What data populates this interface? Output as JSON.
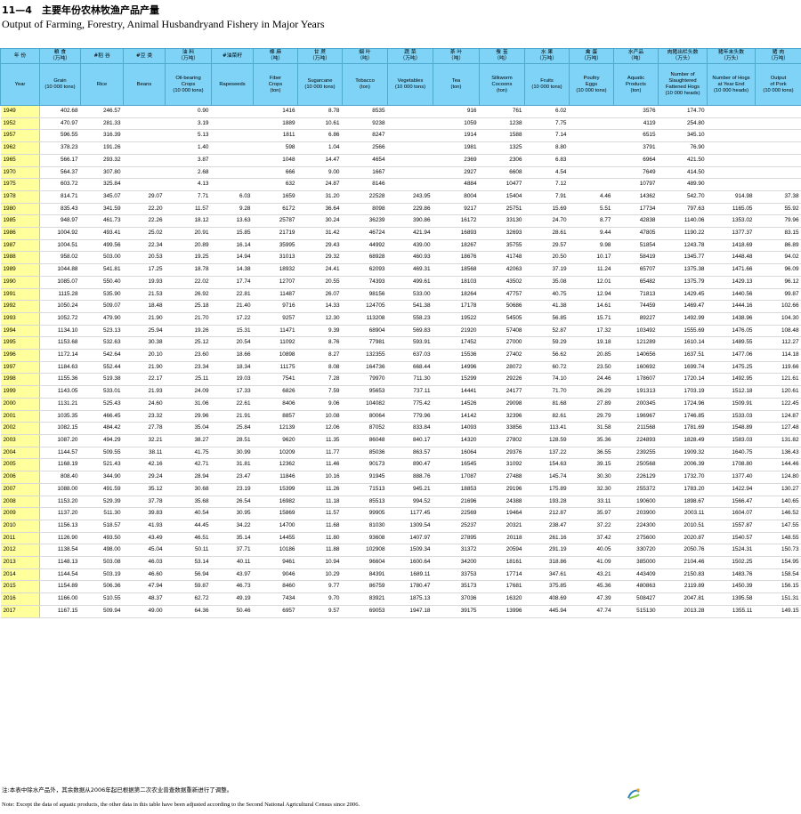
{
  "title": {
    "cn": "11—4　主要年份农林牧渔产品产量",
    "en": "Output of Farming, Forestry, Animal Husbandryand Fishery in Major Years"
  },
  "header_cn": [
    "年 份",
    "粮 食\n（万吨）",
    "#稻 谷",
    "#豆 类",
    "油 料\n（万吨）",
    "#油菜籽",
    "棉 麻\n（吨）",
    "甘 蔗\n（万吨）",
    "烟 叶\n（吨）",
    "蔬 菜\n（万吨）",
    "茶 叶\n（吨）",
    "蚕 茧\n（吨）",
    "水 果\n（万吨）",
    "禽 蛋\n（万吨）",
    "水产品\n（吨）",
    "肉猪出栏头数\n（万头）",
    "猪年末头数\n（万头）",
    "猪 肉\n（万吨）"
  ],
  "header_en": [
    "Year",
    "Grain\n(10 000 tons)",
    "Rice",
    "Beans",
    "Oil-bearing\nCrops\n(10 000 tons)",
    "Rapeseeds",
    "Fiber\nCrops\n(ton)",
    "Sugarcane\n(10 000 tons)",
    "Tobacco\n(ton)",
    "Vegetables\n(10 000 tons)",
    "Tea\n(ton)",
    "Silkworm\nCocoons\n(ton)",
    "Fruits\n(10 000 tons)",
    "Poultry\nEggs\n(10 000 tons)",
    "Aquatic\nProducts\n(ton)",
    "Number of\nSlaughtered\nFattened Hogs\n(10 000 heads)",
    "Number of Hogs\nat Year End\n(10 000 heads)",
    "Output\nof Pork\n(10 000 tons)"
  ],
  "rows": [
    [
      "1949",
      "402.68",
      "246.57",
      "",
      "0.90",
      "",
      "1416",
      "8.78",
      "8535",
      "",
      "916",
      "761",
      "6.02",
      "",
      "3576",
      "174.70",
      "",
      ""
    ],
    [
      "1952",
      "470.97",
      "281.33",
      "",
      "3.19",
      "",
      "1889",
      "10.61",
      "9238",
      "",
      "1059",
      "1238",
      "7.75",
      "",
      "4119",
      "254.80",
      "",
      ""
    ],
    [
      "1957",
      "596.55",
      "316.39",
      "",
      "5.13",
      "",
      "1811",
      "6.86",
      "8247",
      "",
      "1914",
      "1588",
      "7.14",
      "",
      "6515",
      "345.10",
      "",
      ""
    ],
    [
      "1962",
      "378.23",
      "191.26",
      "",
      "1.40",
      "",
      "598",
      "1.04",
      "2566",
      "",
      "1981",
      "1325",
      "8.80",
      "",
      "3791",
      "76.90",
      "",
      ""
    ],
    [
      "1965",
      "566.17",
      "293.32",
      "",
      "3.87",
      "",
      "1048",
      "14.47",
      "4654",
      "",
      "2369",
      "2306",
      "6.83",
      "",
      "6964",
      "421.50",
      "",
      ""
    ],
    [
      "1970",
      "564.37",
      "307.80",
      "",
      "2.68",
      "",
      "666",
      "9.00",
      "1667",
      "",
      "2927",
      "6608",
      "4.54",
      "",
      "7649",
      "414.50",
      "",
      ""
    ],
    [
      "1975",
      "603.72",
      "325.84",
      "",
      "4.13",
      "",
      "632",
      "24.87",
      "8146",
      "",
      "4884",
      "10477",
      "7.12",
      "",
      "10797",
      "489.90",
      "",
      ""
    ],
    [
      "1978",
      "814.71",
      "345.07",
      "29.07",
      "7.71",
      "6.03",
      "1659",
      "31.20",
      "22528",
      "243.95",
      "8004",
      "15404",
      "7.91",
      "4.46",
      "14362",
      "542.70",
      "914.98",
      "37.38"
    ],
    [
      "1980",
      "835.43",
      "341.59",
      "22.20",
      "11.57",
      "9.28",
      "6172",
      "36.64",
      "8098",
      "229.86",
      "9217",
      "25751",
      "15.69",
      "5.51",
      "17734",
      "797.63",
      "1165.05",
      "55.92"
    ],
    [
      "1985",
      "948.97",
      "461.73",
      "22.26",
      "18.12",
      "13.63",
      "25787",
      "30.24",
      "36239",
      "390.86",
      "16172",
      "33130",
      "24.70",
      "8.77",
      "42838",
      "1140.06",
      "1353.02",
      "79.96"
    ],
    [
      "1986",
      "1004.92",
      "493.41",
      "25.02",
      "20.91",
      "15.85",
      "21719",
      "31.42",
      "46724",
      "421.94",
      "16893",
      "32693",
      "28.61",
      "9.44",
      "47805",
      "1190.22",
      "1377.37",
      "83.15"
    ],
    [
      "1987",
      "1004.51",
      "499.56",
      "22.34",
      "20.89",
      "16.14",
      "35995",
      "29.43",
      "44992",
      "439.00",
      "18267",
      "35755",
      "29.57",
      "9.98",
      "51854",
      "1243.78",
      "1418.69",
      "86.89"
    ],
    [
      "1988",
      "958.02",
      "503.00",
      "20.53",
      "19.25",
      "14.94",
      "31013",
      "29.32",
      "68928",
      "460.93",
      "18676",
      "41748",
      "20.50",
      "10.17",
      "58419",
      "1345.77",
      "1448.48",
      "94.02"
    ],
    [
      "1989",
      "1044.88",
      "541.81",
      "17.25",
      "18.78",
      "14.38",
      "18932",
      "24.41",
      "62093",
      "469.31",
      "18568",
      "42063",
      "37.19",
      "11.24",
      "65707",
      "1375.38",
      "1471.66",
      "96.09"
    ],
    [
      "1990",
      "1085.07",
      "550.40",
      "19.93",
      "22.02",
      "17.74",
      "12707",
      "20.55",
      "74393",
      "499.61",
      "18103",
      "43502",
      "35.08",
      "12.01",
      "65482",
      "1375.79",
      "1429.13",
      "96.12"
    ],
    [
      "1991",
      "1115.28",
      "535.90",
      "21.53",
      "26.92",
      "22.81",
      "11487",
      "26.07",
      "98156",
      "533.00",
      "18264",
      "47757",
      "40.75",
      "12.94",
      "71813",
      "1429.45",
      "1440.56",
      "99.87"
    ],
    [
      "1992",
      "1050.24",
      "509.07",
      "18.48",
      "25.18",
      "21.40",
      "9716",
      "14.33",
      "124705",
      "541.38",
      "17178",
      "50686",
      "41.38",
      "14.61",
      "74459",
      "1469.47",
      "1444.16",
      "102.66"
    ],
    [
      "1993",
      "1052.72",
      "479.90",
      "21.90",
      "21.70",
      "17.22",
      "9257",
      "12.30",
      "113208",
      "558.23",
      "19522",
      "54505",
      "56.85",
      "15.71",
      "89227",
      "1492.99",
      "1438.96",
      "104.30"
    ],
    [
      "1994",
      "1134.10",
      "523.13",
      "25.94",
      "19.26",
      "15.31",
      "11471",
      "9.39",
      "68904",
      "569.83",
      "21920",
      "57408",
      "52.87",
      "17.32",
      "103492",
      "1555.69",
      "1476.05",
      "108.48"
    ],
    [
      "1995",
      "1153.68",
      "532.63",
      "30.38",
      "25.12",
      "20.54",
      "11092",
      "8.76",
      "77981",
      "593.91",
      "17452",
      "27000",
      "59.29",
      "19.18",
      "121289",
      "1610.14",
      "1489.55",
      "112.27"
    ],
    [
      "1996",
      "1172.14",
      "542.64",
      "20.10",
      "23.60",
      "18.66",
      "10898",
      "8.27",
      "132355",
      "637.03",
      "15536",
      "27402",
      "56.62",
      "20.85",
      "140656",
      "1637.51",
      "1477.06",
      "114.18"
    ],
    [
      "1997",
      "1184.63",
      "552.44",
      "21.90",
      "23.34",
      "18.34",
      "11175",
      "8.08",
      "164736",
      "668.44",
      "14996",
      "28072",
      "60.72",
      "23.50",
      "160692",
      "1699.74",
      "1475.25",
      "119.66"
    ],
    [
      "1998",
      "1155.36",
      "519.38",
      "22.17",
      "25.11",
      "19.03",
      "7541",
      "7.28",
      "79970",
      "711.30",
      "15299",
      "29226",
      "74.10",
      "24.46",
      "178607",
      "1720.14",
      "1492.95",
      "121.61"
    ],
    [
      "1999",
      "1143.05",
      "533.01",
      "21.93",
      "24.09",
      "17.33",
      "6826",
      "7.59",
      "95653",
      "737.11",
      "14441",
      "24177",
      "71.70",
      "26.29",
      "191313",
      "1703.19",
      "1512.18",
      "120.61"
    ],
    [
      "2000",
      "1131.21",
      "525.43",
      "24.60",
      "31.06",
      "22.61",
      "8406",
      "9.06",
      "104082",
      "775.42",
      "14526",
      "29098",
      "81.68",
      "27.89",
      "200345",
      "1724.96",
      "1509.91",
      "122.45"
    ],
    [
      "2001",
      "1035.35",
      "466.45",
      "23.32",
      "29.96",
      "21.91",
      "8857",
      "10.08",
      "80064",
      "779.96",
      "14142",
      "32396",
      "82.61",
      "29.79",
      "196967",
      "1746.85",
      "1533.03",
      "124.87"
    ],
    [
      "2002",
      "1082.15",
      "484.42",
      "27.78",
      "35.04",
      "25.84",
      "12139",
      "12.06",
      "87052",
      "833.84",
      "14093",
      "33856",
      "113.41",
      "31.58",
      "211568",
      "1781.69",
      "1548.89",
      "127.48"
    ],
    [
      "2003",
      "1087.20",
      "494.29",
      "32.21",
      "38.27",
      "28.51",
      "9620",
      "11.35",
      "86048",
      "840.17",
      "14320",
      "27802",
      "128.59",
      "35.36",
      "224893",
      "1828.49",
      "1583.03",
      "131.82"
    ],
    [
      "2004",
      "1144.57",
      "509.55",
      "38.11",
      "41.75",
      "30.99",
      "10209",
      "11.77",
      "85036",
      "863.57",
      "16064",
      "29376",
      "137.22",
      "36.55",
      "239255",
      "1909.32",
      "1640.75",
      "136.43"
    ],
    [
      "2005",
      "1168.19",
      "521.43",
      "42.16",
      "42.71",
      "31.81",
      "12362",
      "11.46",
      "90173",
      "890.47",
      "16545",
      "31092",
      "154.63",
      "39.15",
      "250568",
      "2006.39",
      "1708.80",
      "144.46"
    ],
    [
      "2006",
      "808.40",
      "344.90",
      "29.24",
      "28.94",
      "23.47",
      "11846",
      "10.16",
      "91945",
      "888.76",
      "17087",
      "27488",
      "145.74",
      "30.30",
      "226129",
      "1732.70",
      "1377.40",
      "124.80"
    ],
    [
      "2007",
      "1088.00",
      "491.59",
      "35.12",
      "30.68",
      "23.19",
      "15399",
      "11.26",
      "71513",
      "945.21",
      "18853",
      "29196",
      "175.89",
      "32.30",
      "255372",
      "1783.20",
      "1422.94",
      "130.27"
    ],
    [
      "2008",
      "1153.20",
      "529.39",
      "37.78",
      "35.68",
      "26.54",
      "16982",
      "11.18",
      "85513",
      "994.52",
      "21696",
      "24388",
      "193.28",
      "33.11",
      "190600",
      "1898.67",
      "1566.47",
      "140.65"
    ],
    [
      "2009",
      "1137.20",
      "511.30",
      "39.83",
      "40.54",
      "30.95",
      "15869",
      "11.57",
      "99905",
      "1177.45",
      "22569",
      "19464",
      "212.87",
      "35.97",
      "203900",
      "2003.11",
      "1604.07",
      "146.52"
    ],
    [
      "2010",
      "1156.13",
      "518.57",
      "41.93",
      "44.45",
      "34.22",
      "14700",
      "11.68",
      "81030",
      "1309.54",
      "25237",
      "20321",
      "238.47",
      "37.22",
      "224300",
      "2010.51",
      "1557.87",
      "147.55"
    ],
    [
      "2011",
      "1126.90",
      "493.50",
      "43.49",
      "46.51",
      "35.14",
      "14455",
      "11.80",
      "93608",
      "1407.97",
      "27895",
      "20118",
      "261.16",
      "37.42",
      "275600",
      "2020.87",
      "1540.57",
      "148.55"
    ],
    [
      "2012",
      "1138.54",
      "498.00",
      "45.04",
      "50.11",
      "37.71",
      "10186",
      "11.88",
      "102908",
      "1509.34",
      "31372",
      "20594",
      "291.19",
      "40.05",
      "330720",
      "2050.76",
      "1524.31",
      "150.73"
    ],
    [
      "2013",
      "1148.13",
      "503.08",
      "46.03",
      "53.14",
      "40.11",
      "9461",
      "10.94",
      "96604",
      "1600.64",
      "34200",
      "18161",
      "318.86",
      "41.09",
      "385000",
      "2104.46",
      "1502.25",
      "154.95"
    ],
    [
      "2014",
      "1144.54",
      "503.19",
      "46.60",
      "56.94",
      "43.97",
      "9046",
      "10.29",
      "84391",
      "1689.11",
      "33753",
      "17714",
      "347.61",
      "43.21",
      "443409",
      "2150.83",
      "1483.76",
      "158.54"
    ],
    [
      "2015",
      "1154.89",
      "506.36",
      "47.94",
      "59.87",
      "46.73",
      "8460",
      "9.77",
      "86759",
      "1780.47",
      "35173",
      "17681",
      "375.85",
      "45.36",
      "480863",
      "2119.89",
      "1450.39",
      "156.15"
    ],
    [
      "2016",
      "1166.00",
      "510.55",
      "48.37",
      "62.72",
      "49.19",
      "7434",
      "9.70",
      "83921",
      "1875.13",
      "37036",
      "16320",
      "408.69",
      "47.39",
      "508427",
      "2047.81",
      "1395.58",
      "151.31"
    ],
    [
      "2017",
      "1167.15",
      "509.94",
      "49.00",
      "64.36",
      "50.46",
      "6957",
      "9.57",
      "69053",
      "1947.18",
      "39175",
      "13996",
      "445.94",
      "47.74",
      "515130",
      "2013.28",
      "1355.11",
      "149.15"
    ]
  ],
  "notes": {
    "cn": "注:本表中除水产品外，其余数据从2006年起已根据第二次农业普查数据重新进行了调整。",
    "en": "Note: Except the data of aquatic products, the other data in this table have been adjusted according to the Second National Agricultural Census since 2006."
  },
  "colors": {
    "header_bg": "#7fd3f7",
    "year_col_bg": "#ffff9c"
  },
  "icons": {
    "logo": "publisher-logo-icon"
  }
}
